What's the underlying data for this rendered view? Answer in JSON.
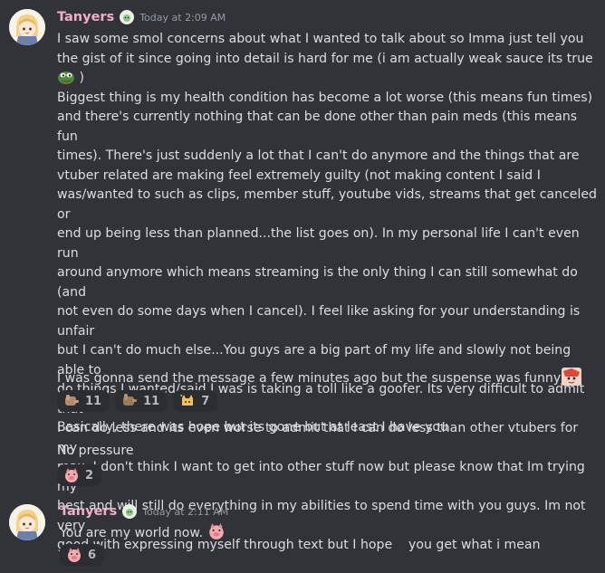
{
  "messages": [
    {
      "username": "Tanyers",
      "timestamp": "Today at 2:09 AM",
      "body": "I saw some smol concerns about what I wanted to talk about so Imma just tell you the gist of it since going into detail is hard for me (i am actually weak sauce its true",
      "body_after_emoji": " )\nBiggest thing is my health condition has become a lot worse (this means fun times)\nand there's currently nothing that can be done other than pain meds (this means fun\ntimes). There's just suddenly a lot that I can't do anymore and the things that are\nvtuber related are making feel extremely guilty (not making content I said I\nwas/wanted to such as clips, member stuff, youtube vids, streams that get canceled or\nend up being less than planned...the list goes on). In my personal life I can't even run\naround anymore which means streaming is the only thing I can still somewhat do (and\nnot even do some days when I cancel). I feel like asking for your understanding is unfair\nbut I can't do much else...You guys are a big part of my life and slowly not being able to\ndo things I wanted/said I was is taking a toll like a goofer. Its very difficult to admit that\nI can do less and its even worse to admit that I can do less than other vtubers for my\nmax. I don't think I want to get into other stuff now but please know that Im trying my\nbest and will still do everything in my abilities to spend time with you guys. Im not very\ngood with expressing myself through text but I hope    you get what i mean",
      "followup": "I was gonna send the message a few minutes ago but the suspense was funny",
      "reactions": [
        {
          "emoji": "hand-pat-emoji",
          "count": "11"
        },
        {
          "emoji": "hand-pat-emoji-2",
          "count": "11"
        },
        {
          "emoji": "sparkle-cat-emoji",
          "count": "7"
        }
      ]
    },
    {
      "body": "Basically, there was hope but its gone but at least I have you"
    },
    {
      "body": "No pressure",
      "reactions": [
        {
          "emoji": "pig-face-emoji",
          "count": "2"
        }
      ]
    },
    {
      "username": "Tanyers",
      "timestamp": "Today at 2:11 AM",
      "body": "You are my world now.",
      "reactions": [
        {
          "emoji": "pig-face-emoji",
          "count": "6"
        }
      ]
    }
  ],
  "colors": {
    "background": "#313338",
    "username": "#f0b1c8",
    "text": "#dbdee1",
    "timestamp": "#949ba4",
    "reaction_bg": "#2b2d31"
  }
}
